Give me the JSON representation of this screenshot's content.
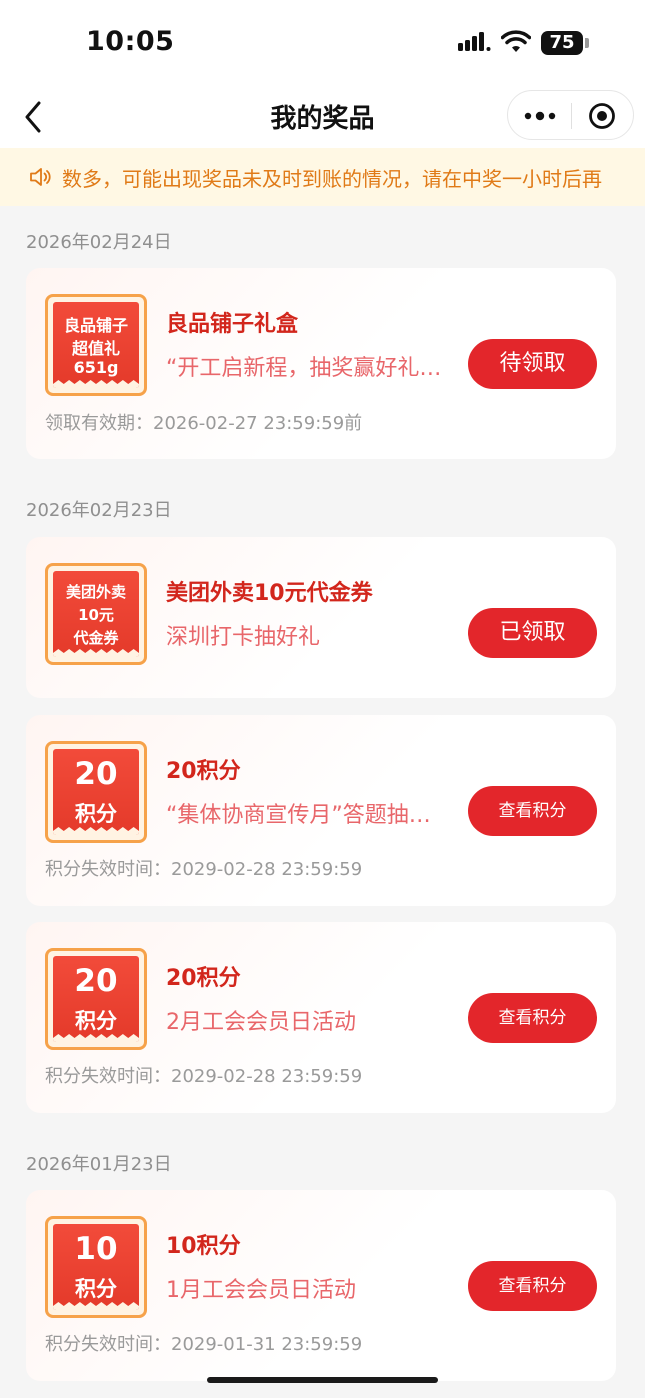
{
  "status_bar": {
    "time": "10:05",
    "battery": "75"
  },
  "nav": {
    "title": "我的奖品"
  },
  "notice": {
    "text": "数多，可能出现奖品未及时到账的情况，请在中奖一小时后再"
  },
  "groups": [
    {
      "date": "2026年02月24日"
    },
    {
      "date": "2026年02月23日"
    },
    {
      "date": "2026年01月23日"
    }
  ],
  "prizes": [
    {
      "icon_lines": [
        "良品铺子",
        "超值礼",
        "651g"
      ],
      "name": "良品铺子礼盒",
      "sub": "“开工启新程，抽奖赢好礼…",
      "meta": "领取有效期：2026-02-27 23:59:59前",
      "button": "待领取"
    },
    {
      "icon_lines": [
        "美团外卖",
        "10元",
        "代金券"
      ],
      "name": "美团外卖10元代金券",
      "sub": "深圳打卡抽好礼",
      "button": "已领取"
    },
    {
      "icon_lines": [
        "20",
        "积分"
      ],
      "name": "20积分",
      "sub": "“集体协商宣传月”答题抽…",
      "meta": "积分失效时间：2029-02-28 23:59:59",
      "button": "查看积分"
    },
    {
      "icon_lines": [
        "20",
        "积分"
      ],
      "name": "20积分",
      "sub": "2月工会会员日活动",
      "meta": "积分失效时间：2029-02-28 23:59:59",
      "button": "查看积分"
    },
    {
      "icon_lines": [
        "10",
        "积分"
      ],
      "name": "10积分",
      "sub": "1月工会会员日活动",
      "meta": "积分失效时间：2029-01-31 23:59:59",
      "button": "查看积分"
    }
  ],
  "icons": {
    "back": "chevron-left-icon",
    "more": "more-dots-icon",
    "close": "target-circle-icon",
    "notice": "speaker-icon"
  },
  "colors": {
    "accent": "#e3262b",
    "prize_name": "#d2261c",
    "notice": "#e07a17"
  }
}
